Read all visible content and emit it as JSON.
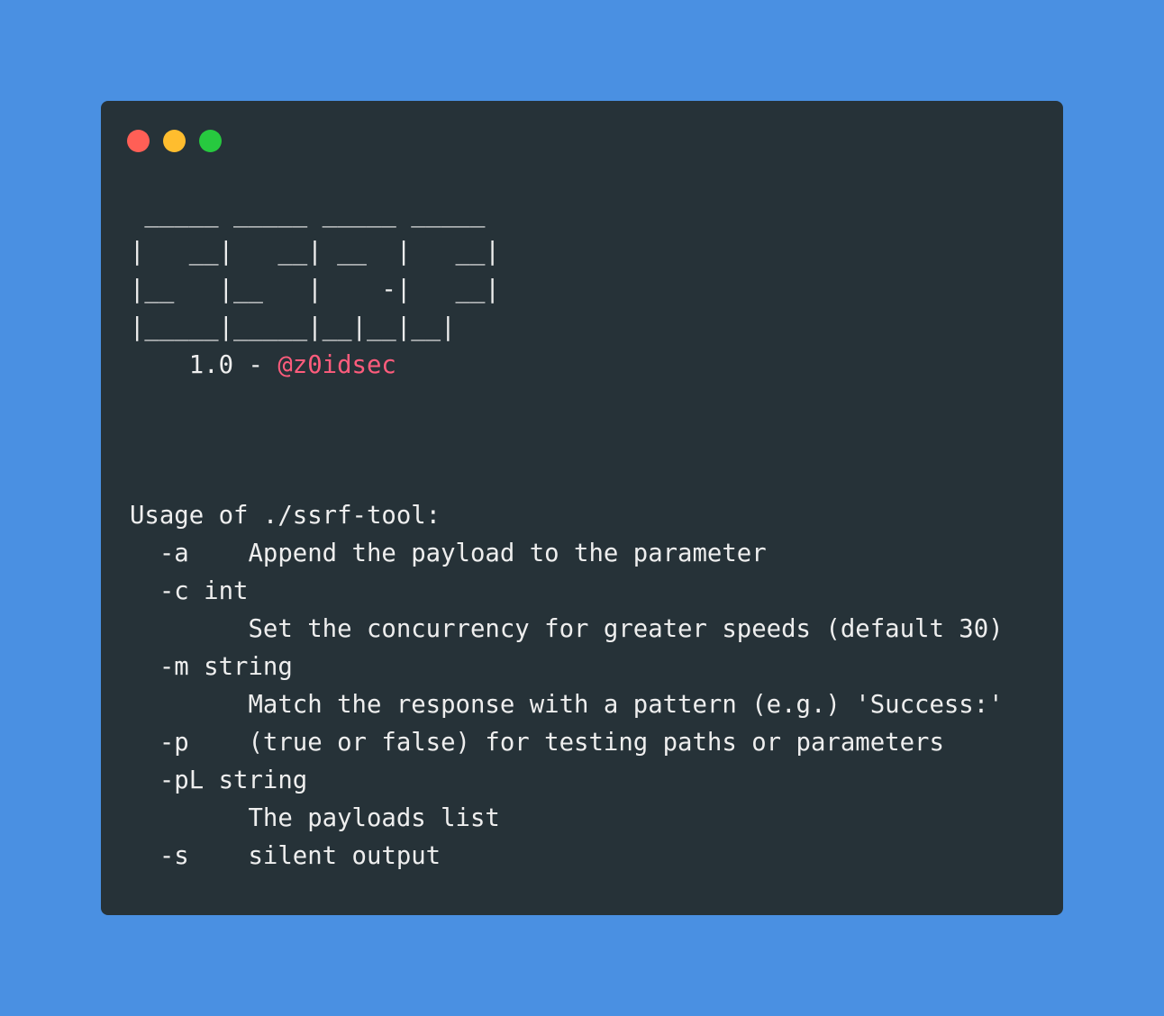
{
  "window": {
    "controls": {
      "close_color": "#ff5f56",
      "minimize_color": "#ffbd2e",
      "maximize_color": "#27c93f"
    }
  },
  "banner": {
    "ascii_lines": [
      " _____ _____ _____ _____",
      "|   __|   __| __  |   __|",
      "|__   |__   |    -|   __|",
      "|_____|_____|__|__|__|"
    ],
    "version_prefix": "    1.0 - ",
    "author": "@z0idsec"
  },
  "usage": {
    "header": "Usage of ./ssrf-tool:",
    "lines": [
      "  -a    Append the payload to the parameter",
      "  -c int",
      "        Set the concurrency for greater speeds (default 30)",
      "  -m string",
      "        Match the response with a pattern (e.g.) 'Success:'",
      "  -p    (true or false) for testing paths or parameters",
      "  -pL string",
      "        The payloads list",
      "  -s    silent output"
    ]
  },
  "colors": {
    "background": "#4a90e2",
    "terminal": "#263238",
    "text": "#eeeeee",
    "author": "#ff5c7c"
  }
}
